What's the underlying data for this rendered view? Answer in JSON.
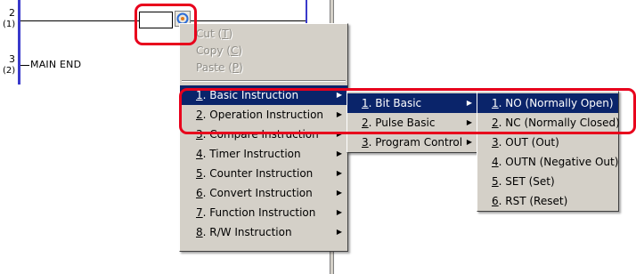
{
  "ladder": {
    "rungs": [
      {
        "number": "2",
        "step": "(1)"
      },
      {
        "number": "3",
        "step": "(2)"
      }
    ],
    "main_end": "MAIN END"
  },
  "context_menu": {
    "items": [
      {
        "key": "Cut",
        "accel": "T",
        "label_suffix": ")",
        "disabled": true
      },
      {
        "key": "Copy",
        "accel": "C",
        "label_suffix": ")",
        "disabled": true
      },
      {
        "key": "Paste",
        "accel": "P",
        "label_suffix": ")",
        "disabled": true
      }
    ],
    "cut_pre": "Cut (",
    "cut_acc": "T",
    "cut_post": ")",
    "copy_pre": "Copy (",
    "copy_acc": "C",
    "copy_post": ")",
    "paste_pre": "Paste (",
    "paste_acc": "P",
    "paste_post": ")",
    "instructions": [
      {
        "num": "1",
        "text": ". Basic Instruction",
        "submenu": true,
        "selected": true
      },
      {
        "num": "2",
        "text": ". Operation Instruction",
        "submenu": true
      },
      {
        "num": "3",
        "text": ". Compare Instruction",
        "submenu": true
      },
      {
        "num": "4",
        "text": ". Timer Instruction",
        "submenu": true
      },
      {
        "num": "5",
        "text": ". Counter Instruction",
        "submenu": true
      },
      {
        "num": "6",
        "text": ". Convert Instruction",
        "submenu": true
      },
      {
        "num": "7",
        "text": ". Function Instruction",
        "submenu": true
      },
      {
        "num": "8",
        "text": ". R/W Instruction",
        "submenu": true
      }
    ]
  },
  "basic_submenu": {
    "items": [
      {
        "num": "1",
        "text": ". Bit Basic",
        "selected": true
      },
      {
        "num": "2",
        "text": ". Pulse Basic"
      },
      {
        "num": "3",
        "text": ". Program Control"
      }
    ]
  },
  "bit_submenu": {
    "items": [
      {
        "num": "1",
        "text": ". NO (Normally Open)",
        "selected": true
      },
      {
        "num": "2",
        "text": ". NC (Normally Closed)"
      },
      {
        "num": "3",
        "text": ". OUT (Out)"
      },
      {
        "num": "4",
        "text": ". OUTN (Negative Out)"
      },
      {
        "num": "5",
        "text": ". SET (Set)"
      },
      {
        "num": "6",
        "text": ". RST (Reset)"
      }
    ]
  },
  "colors": {
    "highlight_bg": "#0a246a",
    "menu_bg": "#d4d0c8",
    "rail": "#3a3acb",
    "annotation_red": "#e8001c"
  },
  "icons": {
    "submenu_arrow": "▶"
  }
}
